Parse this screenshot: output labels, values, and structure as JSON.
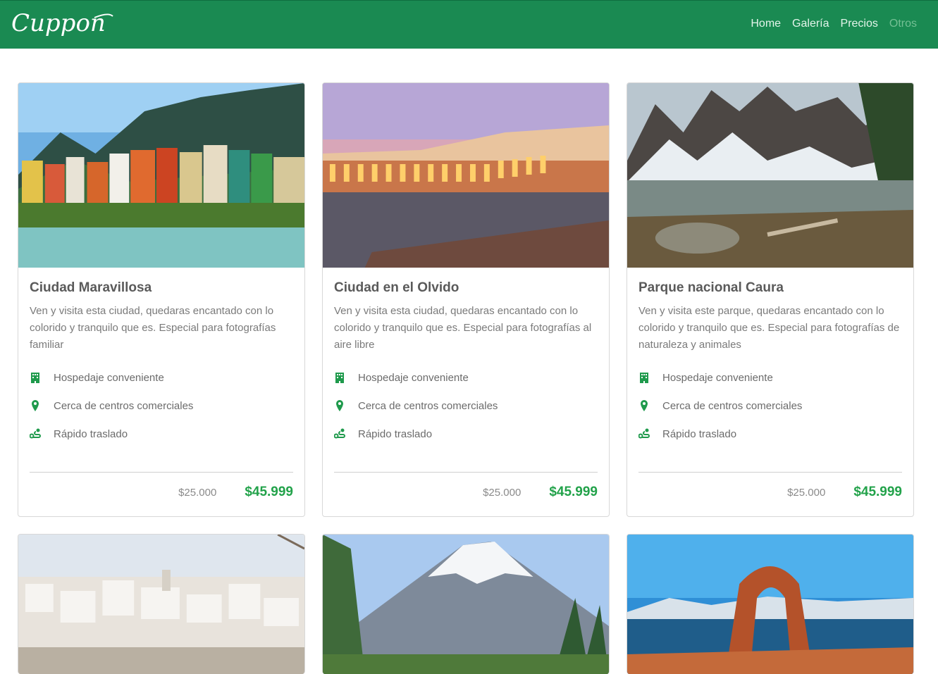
{
  "nav": {
    "brand": "Cuppon",
    "links": [
      {
        "label": "Home"
      },
      {
        "label": "Galería"
      },
      {
        "label": "Precios"
      },
      {
        "label": "Otros"
      }
    ]
  },
  "cards": [
    {
      "title": "Ciudad Maravillosa",
      "description": "Ven y visita esta ciudad, quedaras encantado con lo colorido y tranquilo que es. Especial para fotografías familiar",
      "features": [
        "Hospedaje conveniente",
        "Cerca de centros comerciales",
        "Rápido traslado"
      ],
      "old_price": "$25.000",
      "price": "$45.999"
    },
    {
      "title": "Ciudad en el Olvido",
      "description": "Ven y visita esta ciudad, quedaras encantado con lo colorido y tranquilo que es. Especial para fotografías al aire libre",
      "features": [
        "Hospedaje conveniente",
        "Cerca de centros comerciales",
        "Rápido traslado"
      ],
      "old_price": "$25.000",
      "price": "$45.999"
    },
    {
      "title": "Parque nacional Caura",
      "description": "Ven y visita este parque, quedaras encantado con lo colorido y tranquilo que es. Especial para fotografías de naturaleza y animales",
      "features": [
        "Hospedaje conveniente",
        "Cerca de centros comerciales",
        "Rápido traslado"
      ],
      "old_price": "$25.000",
      "price": "$45.999"
    }
  ],
  "colors": {
    "navbar": "#1a8a52",
    "accent_price": "#22a24a",
    "icon_green": "#1f9a4c"
  },
  "icons": {
    "feature_1": "building-icon",
    "feature_2": "map-pin-icon",
    "feature_3": "route-icon"
  }
}
